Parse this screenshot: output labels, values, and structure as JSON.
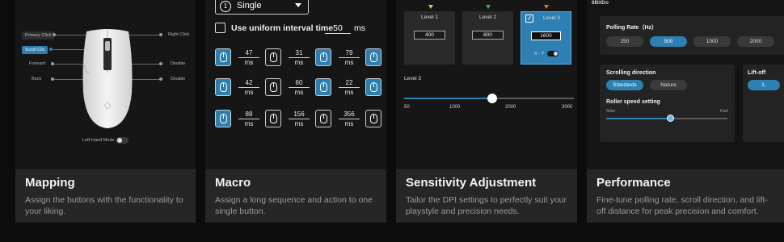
{
  "mapping": {
    "labels": {
      "primary": "Primary Click",
      "right": "Right Click",
      "scroll": "Scroll Clic",
      "forward": "Forward",
      "back": "Back",
      "disable1": "Disable",
      "disable2": "Disable"
    },
    "left_hand": "Left-Hand Mode",
    "title": "Mapping",
    "desc": "Assign the buttons with the functionality to your liking."
  },
  "macro": {
    "mode": "Single",
    "mode_index": "1",
    "uniform_label": "Use uniform interval time",
    "uniform_value": "50",
    "uniform_unit": "ms",
    "rows": [
      [
        "47",
        "31",
        "79"
      ],
      [
        "42",
        "60",
        "22"
      ],
      [
        "88",
        "156",
        "356"
      ]
    ],
    "unit": "ms",
    "title": "Macro",
    "desc": "Assign a long sequence and action to one single button."
  },
  "sensitivity": {
    "levels": [
      {
        "name": "Level 1",
        "value": "400",
        "color": "#e8c33a"
      },
      {
        "name": "Level 2",
        "value": "800",
        "color": "#3fb34a"
      },
      {
        "name": "Level 3",
        "value": "1600",
        "color": "#e8772a"
      }
    ],
    "xy": "X - Y",
    "slider_label": "Level 3",
    "ticks": [
      "50",
      "1000",
      "2000",
      "3000"
    ],
    "slider_fraction": 0.52,
    "title": "Sensitivity Adjustment",
    "desc": "Tailor the DPI settings to perfectly suit your playstyle and precision needs."
  },
  "performance": {
    "brand": "8BitDo",
    "polling_label": "Polling Rate（Hz）",
    "polling": [
      "250",
      "500",
      "1000",
      "2000"
    ],
    "polling_selected": "500",
    "scroll_label": "Scrolling direction",
    "scroll_options": [
      "Standards",
      "Nature"
    ],
    "roller_label": "Roller speed setting",
    "slow": "Slow",
    "fast": "Fast",
    "roller_fraction": 0.53,
    "liftoff_label": "Lift-off",
    "liftoff_btn": "1.",
    "title": "Performance",
    "desc": "Fine-tune polling rate, scroll direction, and lift-off distance for peak precision and comfort."
  }
}
